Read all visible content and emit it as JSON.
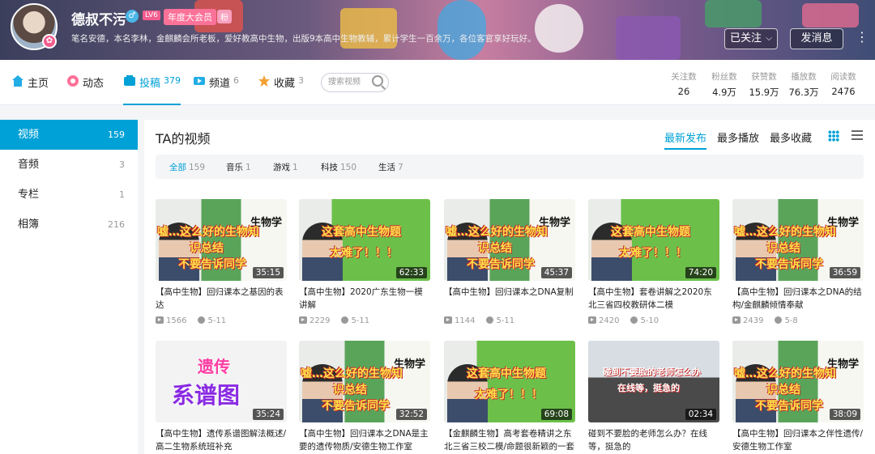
{
  "profile": {
    "name": "德叔不污",
    "gender_symbol": "♂",
    "level": "LV6",
    "vip": "年度大会员",
    "fan_badge": "粉",
    "sign": "笔名安德，本名李林，金麒麟会所老板，爱好教高中生物，出版9本高中生物教辅，累计学生一百余万，各位客官享好玩好。",
    "followed_label": "已关注",
    "message_label": "发消息"
  },
  "nav": {
    "home": "主页",
    "dynamic": "动态",
    "submissions": "投稿",
    "submissions_count": "379",
    "channels": "频道",
    "channels_count": "6",
    "favorites": "收藏",
    "favorites_count": "3",
    "search_placeholder": "搜索视频"
  },
  "stats": [
    {
      "label": "关注数",
      "value": "26"
    },
    {
      "label": "粉丝数",
      "value": "4.9万"
    },
    {
      "label": "获赞数",
      "value": "15.9万"
    },
    {
      "label": "播放数",
      "value": "76.3万"
    },
    {
      "label": "阅读数",
      "value": "2476"
    }
  ],
  "sidebar": [
    {
      "label": "视频",
      "count": "159"
    },
    {
      "label": "音频",
      "count": "3"
    },
    {
      "label": "专栏",
      "count": "1"
    },
    {
      "label": "相簿",
      "count": "216"
    }
  ],
  "main": {
    "title": "TA的视频",
    "sort_latest": "最新发布",
    "sort_most_played": "最多播放",
    "sort_most_fav": "最多收藏"
  },
  "filters": [
    {
      "label": "全部",
      "count": "159"
    },
    {
      "label": "音乐",
      "count": "1"
    },
    {
      "label": "游戏",
      "count": "1"
    },
    {
      "label": "科技",
      "count": "150"
    },
    {
      "label": "生活",
      "count": "7"
    }
  ],
  "videos": [
    {
      "title": "【高中生物】回归课本之基因的表达",
      "plays": "1566",
      "date": "5-11",
      "duration": "35:15",
      "ov1": "嘘…这么好的生物知",
      "ov2": "识总结",
      "ov3": "不要告诉同学",
      "subj": "生物学"
    },
    {
      "title": "【高中生物】2020广东生物一模讲解",
      "plays": "2229",
      "date": "5-11",
      "duration": "62:33",
      "ov1": "这套高中生物题",
      "ov2": "太难了！！！",
      "ov3": "",
      "subj": ""
    },
    {
      "title": "【高中生物】回归课本之DNA复制",
      "plays": "1144",
      "date": "5-11",
      "duration": "45:37",
      "ov1": "嘘…这么好的生物知",
      "ov2": "识总结",
      "ov3": "不要告诉同学",
      "subj": "生物学"
    },
    {
      "title": "【高中生物】套卷讲解之2020东北三省四校教研体二模",
      "plays": "2420",
      "date": "5-10",
      "duration": "74:20",
      "ov1": "这套高中生物题",
      "ov2": "太难了！！！",
      "ov3": "",
      "subj": ""
    },
    {
      "title": "【高中生物】回归课本之DNA的结构/金麒麟倾情奉献",
      "plays": "2439",
      "date": "5-8",
      "duration": "36:59",
      "ov1": "嘘…这么好的生物知",
      "ov2": "识总结",
      "ov3": "不要告诉同学",
      "subj": "生物学"
    },
    {
      "title": "【高中生物】遗传系谱图解法概述/高二生物系统班补充",
      "plays": "",
      "date": "",
      "duration": "35:24",
      "ov1": "遗传",
      "ov2": "系谱图",
      "ov3": "",
      "subj": ""
    },
    {
      "title": "【高中生物】回归课本之DNA是主要的遗传物质/安德生物工作室",
      "plays": "",
      "date": "",
      "duration": "32:52",
      "ov1": "嘘…这么好的生物知",
      "ov2": "识总结",
      "ov3": "不要告诉同学",
      "subj": "生物学"
    },
    {
      "title": "【金麒麟生物】高考套卷精讲之东北三省三校二模/命题很新颖的一套",
      "plays": "",
      "date": "",
      "duration": "69:08",
      "ov1": "这套高中生物题",
      "ov2": "太难了！！！",
      "ov3": "",
      "subj": ""
    },
    {
      "title": "碰到不要脸的老师怎么办？在线等，挺急的",
      "plays": "",
      "date": "",
      "duration": "02:34",
      "ov1": "碰到不要脸的老师怎么办",
      "ov2": "在线等，挺急的",
      "ov3": "",
      "subj": ""
    },
    {
      "title": "【高中生物】回归课本之伴性遗传/安德生物工作室",
      "plays": "",
      "date": "",
      "duration": "38:09",
      "ov1": "嘘…这么好的生物知",
      "ov2": "识总结",
      "ov3": "不要告诉同学",
      "subj": "生物学"
    }
  ],
  "colors": {
    "accent": "#00a1d6",
    "pink": "#fb7299"
  }
}
